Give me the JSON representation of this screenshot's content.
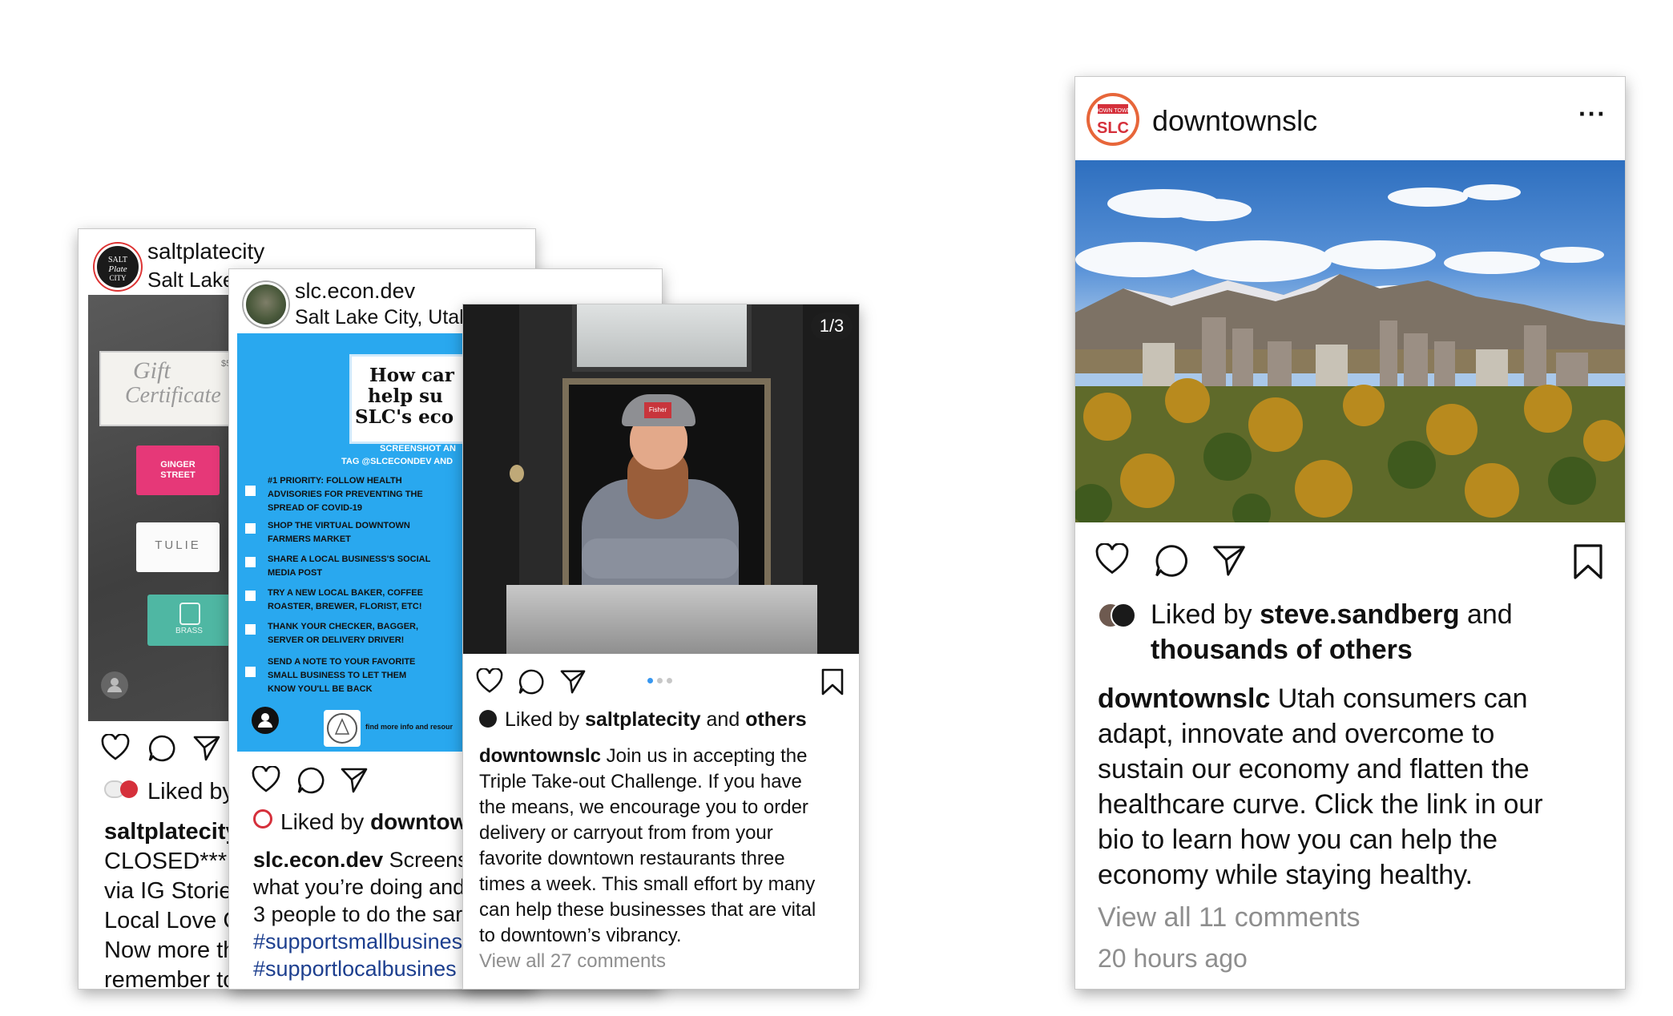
{
  "card1": {
    "username": "saltplatecity",
    "location": "Salt Lake",
    "avatar_text": "SALT Plate CITY",
    "photo": {
      "gift_line1": "Gift",
      "gift_line2": "Certificate",
      "gift_note": "$50 Twenty",
      "ginger": "GINGER STREET",
      "tulie": "TULIE",
      "brass": "BRASS"
    },
    "liked": "Liked by",
    "caption_user": "saltplatecity",
    "caption_lines": [
      "CLOSED*** v",
      "via IG Stories",
      "Local Love G",
      "Now more th",
      "remember to"
    ]
  },
  "card2": {
    "username": "slc.econ.dev",
    "location": "Salt Lake City, Utal",
    "poster": {
      "headline": [
        "How car",
        "help su",
        "SLC's eco"
      ],
      "sub1": "SCREENSHOT AN",
      "sub2": "TAG @SLCECONDEV AND",
      "items": [
        [
          "#1 PRIORITY: FOLLOW HEALTH",
          "ADVISORIES FOR PREVENTING THE",
          "SPREAD OF COVID-19"
        ],
        [
          "SHOP THE VIRTUAL DOWNTOWN",
          "FARMERS MARKET"
        ],
        [
          "SHARE A LOCAL BUSINESS'S SOCIAL",
          "MEDIA POST"
        ],
        [
          "TRY A NEW LOCAL BAKER, COFFEE",
          "ROASTER, BREWER, FLORIST, ETC!"
        ],
        [
          "THANK YOUR CHECKER, BAGGER,",
          "SERVER OR DELIVERY DRIVER!"
        ],
        [
          "SEND A NOTE TO YOUR FAVORITE",
          "SMALL BUSINESS TO LET THEM",
          "KNOW YOU'LL BE BACK"
        ]
      ],
      "footer": "find more info and resour"
    },
    "liked_prefix": "Liked by ",
    "liked_user": "downtow",
    "caption_user": "slc.econ.dev",
    "caption_first": " Screens",
    "caption_lines": [
      "what you’re doing and",
      "3 people to do the sar"
    ],
    "hashtags": [
      "#supportsmallbusines",
      "#supportlocalbusines"
    ]
  },
  "card3": {
    "counter": "1/3",
    "cap_logo": "Fisher",
    "liked_prefix": "Liked by ",
    "liked_user": "saltplatecity",
    "liked_mid": " and ",
    "liked_end": "others",
    "caption_user": "downtownslc",
    "caption_first": " Join us in accepting the",
    "caption_lines": [
      "Triple Take-out Challenge. If you have",
      "the means, we encourage you to order",
      "delivery or carryout from from your",
      "favorite downtown restaurants three",
      "times a week. This small effort by many",
      "can help these businesses that are vital",
      "to downtown’s vibrancy."
    ],
    "comments": "View all 27 comments"
  },
  "card4": {
    "username": "downtownslc",
    "logo_top": "DOWN TOWN",
    "logo_main": "SLC",
    "more": "···",
    "liked_prefix": "Liked by ",
    "liked_user": "steve.sandberg",
    "liked_mid": " and",
    "liked_line2": "thousands of others",
    "caption_user": "downtownslc",
    "caption_first": " Utah consumers can",
    "caption_lines": [
      "adapt, innovate and overcome to",
      "sustain our economy and flatten the",
      "healthcare curve. Click the link in our",
      "bio to learn how you can help the",
      "economy while staying healthy."
    ],
    "comments": "View all 11 comments",
    "time": "20 hours ago"
  },
  "colors": {
    "poster_blue": "#29a8ef",
    "brand_red": "#d5303b",
    "hashtag_blue": "#1d3f8f",
    "muted_grey": "#8e8e8e"
  }
}
